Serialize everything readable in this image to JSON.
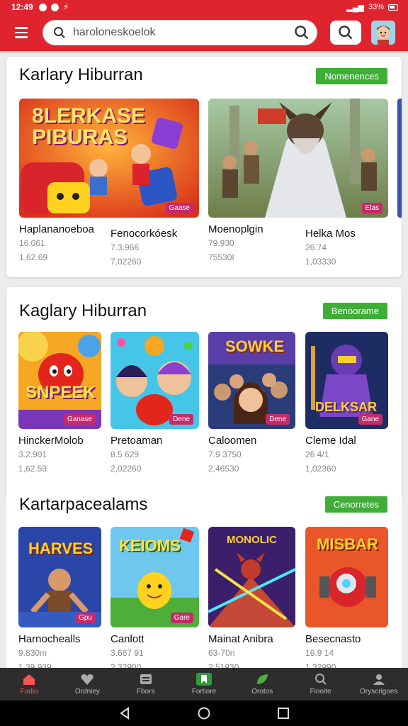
{
  "status": {
    "time": "12:49",
    "battery": "33%"
  },
  "header": {
    "search_value": "haroloneskoelok"
  },
  "sections": [
    {
      "title": "Karlary Hiburran",
      "button": "Nomenences",
      "cards": [
        {
          "name": "Haplananoeboa",
          "meta1": "16.061",
          "meta2": "1,62.69",
          "badge": "Gaase",
          "art": "dice",
          "banner": "8LERKASE PIBURAS"
        },
        {
          "name": "Fenocorkóesk",
          "meta1": "7.3.966",
          "meta2": "7,02260",
          "badge": "",
          "art": "dice2",
          "banner": ""
        },
        {
          "name": "Moenoplgin",
          "meta1": "79.930",
          "meta2": "75530I",
          "badge": "Elas",
          "art": "warrior",
          "banner": ""
        },
        {
          "name": "Helka Mos",
          "meta1": "26.74",
          "meta2": "1,03330",
          "badge": "",
          "art": "warrior2",
          "banner": ""
        }
      ]
    },
    {
      "title": "Kaglary Hiburran",
      "button": "Benoorame",
      "cards": [
        {
          "name": "HinckerMolob",
          "meta1": "3.2.901",
          "meta2": "1,62.59",
          "badge": "Ganase",
          "art": "red",
          "banner": "SNPEEK"
        },
        {
          "name": "Pretoaman",
          "meta1": "8.5 629",
          "meta2": "2,02260",
          "badge": "Dene",
          "art": "cartoon",
          "banner": ""
        },
        {
          "name": "Caloomen",
          "meta1": "7.9 3750",
          "meta2": "2,46530",
          "badge": "Dene",
          "art": "people",
          "banner": "SOWKE"
        },
        {
          "name": "Cleme Idal",
          "meta1": "26 4/1",
          "meta2": "1,02360",
          "badge": "Gane",
          "art": "purple",
          "banner": "DELKSAR"
        }
      ]
    },
    {
      "title": "Kartarpacealams",
      "button": "Cenorretes",
      "cards": [
        {
          "name": "Harnochealls",
          "meta1": "9.830m",
          "meta2": "1,39.939",
          "badge": "Gpu",
          "art": "hero",
          "banner": "HARVES"
        },
        {
          "name": "Canlott",
          "meta1": "3.667 91",
          "meta2": "2,32900",
          "badge": "Gare",
          "art": "yellow",
          "banner": "KEIOMS"
        },
        {
          "name": "Mainat Anibra",
          "meta1": "63-70n",
          "meta2": "2,51930",
          "badge": "",
          "art": "fire",
          "banner": "MONOLIC"
        },
        {
          "name": "Besecnasto",
          "meta1": "16.9 14",
          "meta2": "1,32990",
          "badge": "",
          "art": "robot",
          "banner": "MISBAR"
        }
      ]
    }
  ],
  "bottom_nav": [
    {
      "label": "Fadio",
      "icon": "home-icon",
      "active": true
    },
    {
      "label": "Ordniey",
      "icon": "heart-icon"
    },
    {
      "label": "Fbors",
      "icon": "list-icon"
    },
    {
      "label": "Fortiore",
      "icon": "bookmark-icon",
      "green": true
    },
    {
      "label": "Orotos",
      "icon": "leaf-icon"
    },
    {
      "label": "Fiooite",
      "icon": "search-icon"
    },
    {
      "label": "Oryscrigoes",
      "icon": "person-icon"
    }
  ],
  "colors": {
    "primary": "#e0242f",
    "accent_green": "#3fae36",
    "nav_bg": "#2d2d2d"
  }
}
